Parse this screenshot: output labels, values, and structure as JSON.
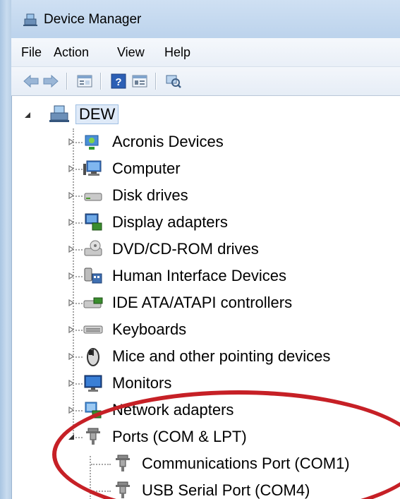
{
  "window": {
    "title": "Device Manager"
  },
  "menu": {
    "file": "File",
    "action": "Action",
    "view": "View",
    "help": "Help"
  },
  "toolbar": {
    "buttons": [
      {
        "name": "back-arrow-icon"
      },
      {
        "name": "forward-arrow-icon"
      },
      {
        "name": "properties-icon"
      },
      {
        "name": "help-icon"
      },
      {
        "name": "view-pane-icon"
      },
      {
        "name": "scan-hardware-icon"
      }
    ]
  },
  "tree": {
    "root": {
      "label": "DEW"
    },
    "categories": [
      {
        "label": "Acronis Devices",
        "icon": "acronis-icon"
      },
      {
        "label": "Computer",
        "icon": "computer-icon"
      },
      {
        "label": "Disk drives",
        "icon": "disk-drive-icon"
      },
      {
        "label": "Display adapters",
        "icon": "display-adapter-icon"
      },
      {
        "label": "DVD/CD-ROM drives",
        "icon": "dvd-drive-icon"
      },
      {
        "label": "Human Interface Devices",
        "icon": "hid-icon"
      },
      {
        "label": "IDE ATA/ATAPI controllers",
        "icon": "ide-controller-icon"
      },
      {
        "label": "Keyboards",
        "icon": "keyboard-icon"
      },
      {
        "label": "Mice and other pointing devices",
        "icon": "mouse-icon"
      },
      {
        "label": "Monitors",
        "icon": "monitor-icon"
      },
      {
        "label": "Network adapters",
        "icon": "network-adapter-icon"
      },
      {
        "label": "Ports (COM & LPT)",
        "icon": "port-icon",
        "expanded": true
      }
    ],
    "ports_children": [
      {
        "label": "Communications Port (COM1)",
        "icon": "port-icon"
      },
      {
        "label": "USB Serial Port (COM4)",
        "icon": "port-icon"
      }
    ]
  },
  "annotation": {
    "color": "#c62026"
  }
}
